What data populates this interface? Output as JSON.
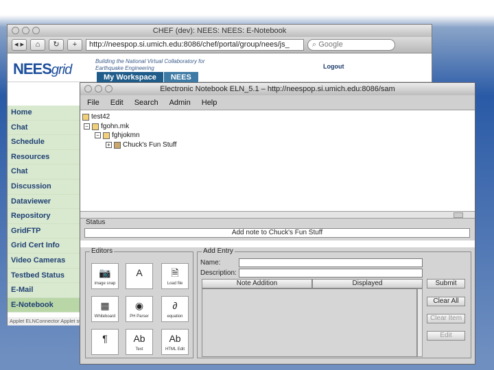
{
  "browser": {
    "title": "CHEF (dev): NEES: NEES: E-Notebook",
    "url": "http://neespop.si.umich.edu:8086/chef/portal/group/nees/js_",
    "search_placeholder": "Google"
  },
  "site": {
    "logo_main": "NEES",
    "logo_sub": "grid",
    "tagline": "Building the National Virtual Collaboratory for Earthquake Engineering",
    "logout": "Logout",
    "tabs": [
      "My Workspace",
      "NEES"
    ]
  },
  "sidebar": {
    "items": [
      {
        "label": "Home"
      },
      {
        "label": "Chat"
      },
      {
        "label": "Schedule"
      },
      {
        "label": "Resources"
      },
      {
        "label": "Chat"
      },
      {
        "label": "Discussion"
      },
      {
        "label": "Dataviewer"
      },
      {
        "label": "Repository"
      },
      {
        "label": "GridFTP"
      },
      {
        "label": "Grid Cert Info"
      },
      {
        "label": "Video Cameras"
      },
      {
        "label": "Testbed Status"
      },
      {
        "label": "E-Mail"
      },
      {
        "label": "E-Notebook"
      }
    ],
    "status": "Applet ELNConnector Applet started"
  },
  "eln": {
    "title": "Electronic Notebook ELN_5.1 – http://neespop.si.umich.edu:8086/sam",
    "menu": [
      "File",
      "Edit",
      "Search",
      "Admin",
      "Help"
    ],
    "tree": [
      "test42",
      "fgohn.mk",
      "fghjokmn",
      "Chuck's Fun Stuff"
    ],
    "status_legend": "Status",
    "status_text": "Add note to Chuck's Fun Stuff",
    "editors_legend": "Editors",
    "editors": [
      "image snap",
      "A",
      "Load file",
      "Whiteboard",
      "PH Parser",
      "equation",
      "Text",
      "HTML Edit"
    ],
    "add_entry_legend": "Add Entry",
    "name_label": "Name:",
    "description_label": "Description:",
    "columns": [
      "Note Addition",
      "Displayed"
    ],
    "buttons": [
      "Submit",
      "Clear All",
      "Clear Item",
      "Edit"
    ]
  }
}
